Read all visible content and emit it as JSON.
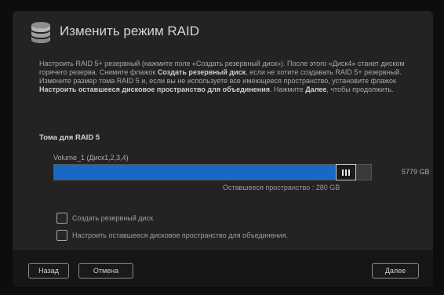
{
  "dialog": {
    "title": "Изменить режим RAID",
    "description_parts": [
      "Настроить RAID 5+ резервный (нажмите поле «Создать резервный диск»). После этого «Диск4» станет диском горячего резерва. Снимите флажок ",
      "Создать резервный диск",
      ", если не хотите создавать RAID 5+ резервный. Измените размер тома RAID 5 и, если вы не используете все имеющееся пространство, установите флажок ",
      "Настроить оставшееся дисковое пространство для объединения",
      ". Нажмите ",
      "Далее",
      ", чтобы продолжить."
    ],
    "section_title": "Тома для RAID 5",
    "volume": {
      "label": "Volume_1 (Диск1,2,3,4)",
      "size": "5779 GB",
      "remaining": "Оставшееся пространство : 280 GB",
      "fill_fraction": 0.954
    },
    "options": [
      {
        "label": "Создать резервный диск",
        "checked": false
      },
      {
        "label": "Настроить оставшееся дисковое пространство для объединения.",
        "checked": false
      }
    ],
    "buttons": {
      "back": "Назад",
      "cancel": "Отмена",
      "next": "Далее"
    }
  },
  "colors": {
    "accent": "#1769c5",
    "background": "#232323",
    "footer": "#161616"
  },
  "icons": {
    "header": "database-icon",
    "handle": "slider-grip-icon"
  }
}
